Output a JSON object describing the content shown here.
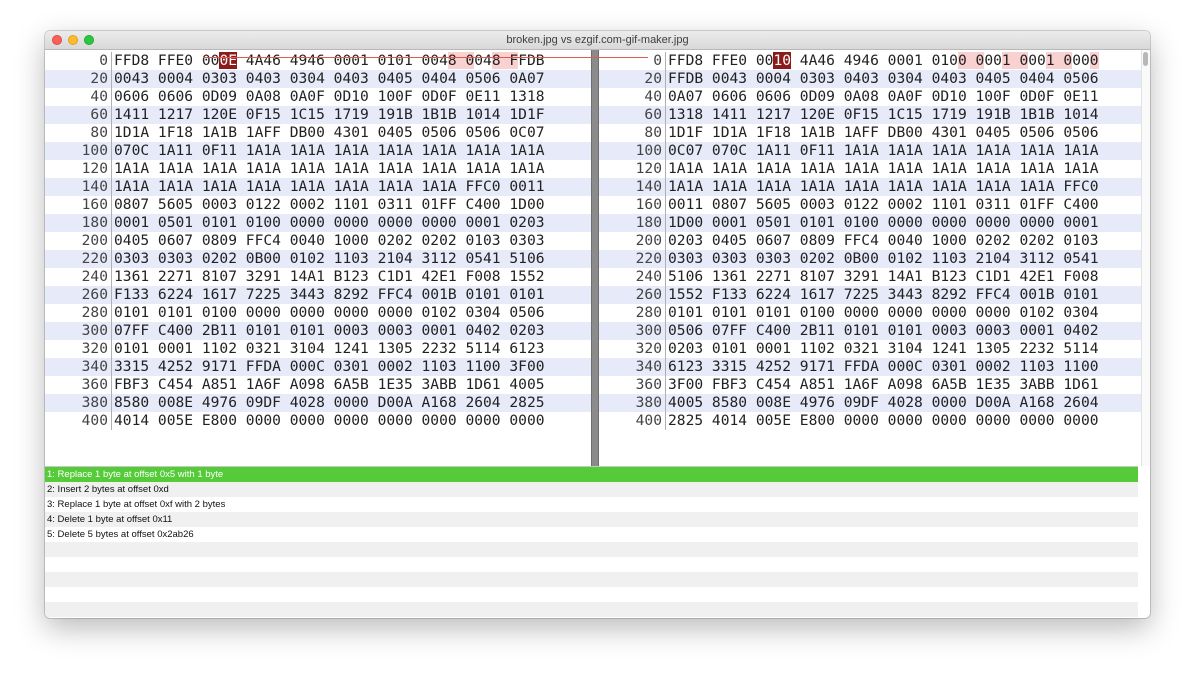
{
  "window": {
    "title": "broken.jpg vs ezgif.com-gif-maker.jpg"
  },
  "left_pane": {
    "rows": [
      {
        "offset": "0",
        "bytes": "FFD8 FFE0 000E 4A46 4946 0001 0101 0048 0048 FFDB"
      },
      {
        "offset": "20",
        "bytes": "0043 0004 0303 0403 0304 0403 0405 0404 0506 0A07"
      },
      {
        "offset": "40",
        "bytes": "0606 0606 0D09 0A08 0A0F 0D10 100F 0D0F 0E11 1318"
      },
      {
        "offset": "60",
        "bytes": "1411 1217 120E 0F15 1C15 1719 191B 1B1B 1014 1D1F"
      },
      {
        "offset": "80",
        "bytes": "1D1A 1F18 1A1B 1AFF DB00 4301 0405 0506 0506 0C07"
      },
      {
        "offset": "100",
        "bytes": "070C 1A11 0F11 1A1A 1A1A 1A1A 1A1A 1A1A 1A1A 1A1A"
      },
      {
        "offset": "120",
        "bytes": "1A1A 1A1A 1A1A 1A1A 1A1A 1A1A 1A1A 1A1A 1A1A 1A1A"
      },
      {
        "offset": "140",
        "bytes": "1A1A 1A1A 1A1A 1A1A 1A1A 1A1A 1A1A 1A1A FFC0 0011"
      },
      {
        "offset": "160",
        "bytes": "0807 5605 0003 0122 0002 1101 0311 01FF C400 1D00"
      },
      {
        "offset": "180",
        "bytes": "0001 0501 0101 0100 0000 0000 0000 0000 0001 0203"
      },
      {
        "offset": "200",
        "bytes": "0405 0607 0809 FFC4 0040 1000 0202 0202 0103 0303"
      },
      {
        "offset": "220",
        "bytes": "0303 0303 0202 0B00 0102 1103 2104 3112 0541 5106"
      },
      {
        "offset": "240",
        "bytes": "1361 2271 8107 3291 14A1 B123 C1D1 42E1 F008 1552"
      },
      {
        "offset": "260",
        "bytes": "F133 6224 1617 7225 3443 8292 FFC4 001B 0101 0101"
      },
      {
        "offset": "280",
        "bytes": "0101 0101 0100 0000 0000 0000 0000 0102 0304 0506"
      },
      {
        "offset": "300",
        "bytes": "07FF C400 2B11 0101 0101 0003 0003 0001 0402 0203"
      },
      {
        "offset": "320",
        "bytes": "0101 0001 1102 0321 3104 1241 1305 2232 5114 6123"
      },
      {
        "offset": "340",
        "bytes": "3315 4252 9171 FFDA 000C 0301 0002 1103 1100 3F00"
      },
      {
        "offset": "360",
        "bytes": "FBF3 C454 A851 1A6F A098 6A5B 1E35 3ABB 1D61 4005"
      },
      {
        "offset": "380",
        "bytes": "8580 008E 4976 09DF 4028 0000 D00A A168 2604 2825"
      },
      {
        "offset": "400",
        "bytes": "4014 005E E800 0000 0000 0000 0000 0000 0000 0000"
      }
    ]
  },
  "right_pane": {
    "rows": [
      {
        "offset": "0",
        "bytes": "FFD8 FFE0 0010 4A46 4946 0001 0100 0001 0001 0000"
      },
      {
        "offset": "20",
        "bytes": "FFDB 0043 0004 0303 0403 0304 0403 0405 0404 0506"
      },
      {
        "offset": "40",
        "bytes": "0A07 0606 0606 0D09 0A08 0A0F 0D10 100F 0D0F 0E11"
      },
      {
        "offset": "60",
        "bytes": "1318 1411 1217 120E 0F15 1C15 1719 191B 1B1B 1014"
      },
      {
        "offset": "80",
        "bytes": "1D1F 1D1A 1F18 1A1B 1AFF DB00 4301 0405 0506 0506"
      },
      {
        "offset": "100",
        "bytes": "0C07 070C 1A11 0F11 1A1A 1A1A 1A1A 1A1A 1A1A 1A1A"
      },
      {
        "offset": "120",
        "bytes": "1A1A 1A1A 1A1A 1A1A 1A1A 1A1A 1A1A 1A1A 1A1A 1A1A"
      },
      {
        "offset": "140",
        "bytes": "1A1A 1A1A 1A1A 1A1A 1A1A 1A1A 1A1A 1A1A 1A1A FFC0"
      },
      {
        "offset": "160",
        "bytes": "0011 0807 5605 0003 0122 0002 1101 0311 01FF C400"
      },
      {
        "offset": "180",
        "bytes": "1D00 0001 0501 0101 0100 0000 0000 0000 0000 0001"
      },
      {
        "offset": "200",
        "bytes": "0203 0405 0607 0809 FFC4 0040 1000 0202 0202 0103"
      },
      {
        "offset": "220",
        "bytes": "0303 0303 0303 0202 0B00 0102 1103 2104 3112 0541"
      },
      {
        "offset": "240",
        "bytes": "5106 1361 2271 8107 3291 14A1 B123 C1D1 42E1 F008"
      },
      {
        "offset": "260",
        "bytes": "1552 F133 6224 1617 7225 3443 8292 FFC4 001B 0101"
      },
      {
        "offset": "280",
        "bytes": "0101 0101 0101 0100 0000 0000 0000 0000 0102 0304"
      },
      {
        "offset": "300",
        "bytes": "0506 07FF C400 2B11 0101 0101 0003 0003 0001 0402"
      },
      {
        "offset": "320",
        "bytes": "0203 0101 0001 1102 0321 3104 1241 1305 2232 5114"
      },
      {
        "offset": "340",
        "bytes": "6123 3315 4252 9171 FFDA 000C 0301 0002 1103 1100"
      },
      {
        "offset": "360",
        "bytes": "3F00 FBF3 C454 A851 1A6F A098 6A5B 1E35 3ABB 1D61"
      },
      {
        "offset": "380",
        "bytes": "4005 8580 008E 4976 09DF 4028 0000 D00A A168 2604"
      },
      {
        "offset": "400",
        "bytes": "2825 4014 005E E800 0000 0000 0000 0000 0000 0000"
      }
    ]
  },
  "changes": {
    "items": [
      {
        "label": "1: Replace 1 byte at offset 0x5 with 1 byte",
        "selected": true
      },
      {
        "label": "2: Insert 2 bytes at offset 0xd",
        "selected": false
      },
      {
        "label": "3: Replace 1 byte at offset 0xf with 2 bytes",
        "selected": false
      },
      {
        "label": "4: Delete 1 byte at offset 0x11",
        "selected": false
      },
      {
        "label": "5: Delete 5 bytes at offset 0x2ab26",
        "selected": false
      }
    ]
  },
  "colors": {
    "selection_green": "#55cb3a",
    "diff_dark_red": "#8b1a1a",
    "diff_light_red": "#f9d1d1",
    "row_alt_blue": "#e6eaf9"
  }
}
